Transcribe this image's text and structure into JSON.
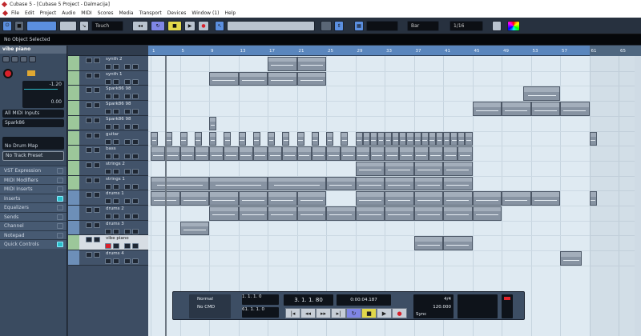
{
  "window": {
    "title": "Cubase 5 - [Cubase 5 Project - Dalmacija]"
  },
  "menu": [
    "File",
    "Edit",
    "Project",
    "Audio",
    "MIDI",
    "Scores",
    "Media",
    "Transport",
    "Devices",
    "Window (1)",
    "Help"
  ],
  "toolbar": {
    "automation_mode": "Touch",
    "grid_type": "Bar",
    "quantize": "1/16",
    "accent_color": "#5b8fe0"
  },
  "infoline": {
    "text": "No Object Selected"
  },
  "inspector": {
    "track_name": "vibe piano",
    "volume": "-1.20",
    "pan": "0.00",
    "input": "All MIDI Inputs",
    "output": "Spark86",
    "drum_map": "No Drum Map",
    "track_preset": "No Track Preset",
    "sections": [
      {
        "label": "VST Expression",
        "active": false
      },
      {
        "label": "MIDI Modifiers",
        "active": false
      },
      {
        "label": "MIDI Inserts",
        "active": false
      },
      {
        "label": "Inserts",
        "active": true
      },
      {
        "label": "Equalizers",
        "active": false
      },
      {
        "label": "Sends",
        "active": false
      },
      {
        "label": "Channel",
        "active": false
      },
      {
        "label": "Notepad",
        "active": false
      },
      {
        "label": "Quick Controls",
        "active": true
      }
    ]
  },
  "ruler": {
    "ticks": [
      "1",
      "5",
      "9",
      "13",
      "17",
      "21",
      "25",
      "29",
      "33",
      "37",
      "41",
      "45",
      "49",
      "53",
      "57",
      "61",
      "65"
    ],
    "project_end_bar": 61,
    "cursor_bar": 3
  },
  "tracks": [
    {
      "name": "synth 2",
      "type": "midi",
      "events": [
        [
          17,
          21
        ],
        [
          21,
          25
        ]
      ]
    },
    {
      "name": "synth 1",
      "type": "midi",
      "events": [
        [
          9,
          13
        ],
        [
          13,
          17
        ],
        [
          17,
          21
        ],
        [
          21,
          25
        ]
      ]
    },
    {
      "name": "Spark86 98",
      "type": "midi",
      "events": [
        [
          52,
          57
        ]
      ]
    },
    {
      "name": "Spark86 98",
      "type": "midi",
      "events": [
        [
          45,
          49
        ],
        [
          49,
          53
        ],
        [
          53,
          57
        ],
        [
          57,
          61
        ]
      ]
    },
    {
      "name": "Spark86 98",
      "type": "midi",
      "events": [
        [
          9,
          10
        ]
      ]
    },
    {
      "name": "guitar",
      "type": "midi",
      "events": [
        [
          1,
          2
        ],
        [
          3,
          4
        ],
        [
          5,
          6
        ],
        [
          7,
          8
        ],
        [
          9,
          10
        ],
        [
          11,
          12
        ],
        [
          13,
          14
        ],
        [
          15,
          16
        ],
        [
          17,
          18
        ],
        [
          19,
          20
        ],
        [
          21,
          22
        ],
        [
          23,
          24
        ],
        [
          25,
          26
        ],
        [
          27,
          28
        ],
        [
          29,
          30
        ],
        [
          30,
          31
        ],
        [
          31,
          32
        ],
        [
          32,
          33
        ],
        [
          33,
          34
        ],
        [
          34,
          35
        ],
        [
          35,
          36
        ],
        [
          36,
          37
        ],
        [
          37,
          38
        ],
        [
          38,
          39
        ],
        [
          39,
          40
        ],
        [
          40,
          41
        ],
        [
          41,
          42
        ],
        [
          42,
          43
        ],
        [
          43,
          44
        ],
        [
          44,
          45
        ],
        [
          61,
          62
        ]
      ]
    },
    {
      "name": "bass",
      "type": "midi",
      "events": [
        [
          1,
          3
        ],
        [
          3,
          5
        ],
        [
          5,
          7
        ],
        [
          7,
          9
        ],
        [
          9,
          11
        ],
        [
          11,
          13
        ],
        [
          13,
          15
        ],
        [
          15,
          17
        ],
        [
          17,
          19
        ],
        [
          19,
          21
        ],
        [
          21,
          23
        ],
        [
          23,
          25
        ],
        [
          25,
          27
        ],
        [
          27,
          29
        ],
        [
          29,
          31
        ],
        [
          31,
          33
        ],
        [
          33,
          35
        ],
        [
          35,
          37
        ],
        [
          37,
          39
        ],
        [
          39,
          41
        ],
        [
          41,
          43
        ],
        [
          43,
          45
        ]
      ]
    },
    {
      "name": "strings 2",
      "type": "midi",
      "events": [
        [
          29,
          33
        ],
        [
          33,
          37
        ],
        [
          37,
          41
        ],
        [
          41,
          45
        ]
      ]
    },
    {
      "name": "strings 1",
      "type": "midi",
      "events": [
        [
          1,
          9
        ],
        [
          9,
          17
        ],
        [
          17,
          25
        ],
        [
          25,
          29
        ],
        [
          29,
          33
        ],
        [
          33,
          37
        ],
        [
          37,
          41
        ],
        [
          41,
          45
        ]
      ]
    },
    {
      "name": "drums 1",
      "type": "audio",
      "events": [
        [
          1,
          5
        ],
        [
          5,
          9
        ],
        [
          9,
          13
        ],
        [
          13,
          17
        ],
        [
          17,
          21
        ],
        [
          21,
          25
        ],
        [
          29,
          33
        ],
        [
          33,
          37
        ],
        [
          37,
          41
        ],
        [
          41,
          45
        ],
        [
          45,
          49
        ],
        [
          49,
          53
        ],
        [
          53,
          57
        ],
        [
          61,
          62
        ]
      ]
    },
    {
      "name": "drums 2",
      "type": "audio",
      "events": [
        [
          9,
          13
        ],
        [
          13,
          17
        ],
        [
          17,
          21
        ],
        [
          21,
          25
        ],
        [
          25,
          29
        ],
        [
          29,
          33
        ],
        [
          33,
          37
        ],
        [
          37,
          41
        ],
        [
          41,
          45
        ],
        [
          45,
          49
        ]
      ]
    },
    {
      "name": "drums 3",
      "type": "audio",
      "events": [
        [
          5,
          9
        ]
      ]
    },
    {
      "name": "vibe piano",
      "type": "midi",
      "selected": true,
      "events": [
        [
          37,
          41
        ],
        [
          41,
          45
        ]
      ]
    },
    {
      "name": "drums 4",
      "type": "audio",
      "events": [
        [
          57,
          60
        ]
      ]
    }
  ],
  "colors": {
    "midi_track": "#9cc79a",
    "audio_track": "#6d8fb8",
    "event": "#8793a2",
    "arrange_bg": "#dfeaf2",
    "record": "#d8202a"
  },
  "transport": {
    "record_mode": "Normal",
    "cycle_mode": "No CMD",
    "left_locator": "1. 1. 1.   0",
    "right_locator": "61. 1. 1.   0",
    "position": "3. 1. 1.  80",
    "time": "0:00:04.187",
    "tempo": "120.000",
    "signature": "4/4",
    "sync": "Sync"
  }
}
